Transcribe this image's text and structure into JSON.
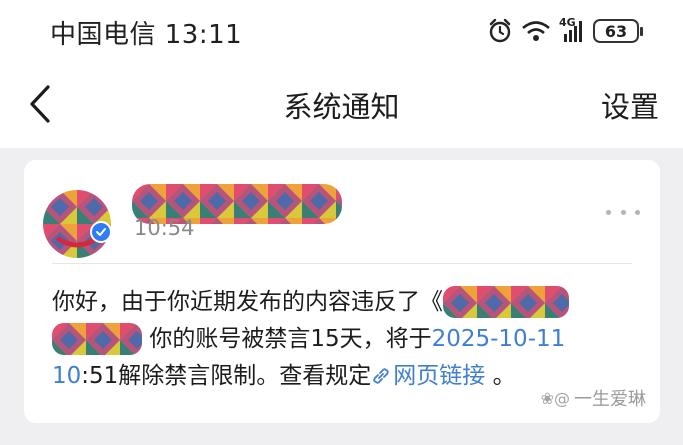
{
  "status_bar": {
    "carrier_time": "中国电信 13:11",
    "battery": "63",
    "network": "4G",
    "icons": [
      "alarm-icon",
      "wifi-icon",
      "signal-icon",
      "battery-icon"
    ]
  },
  "nav": {
    "back_icon": "chevron-left-icon",
    "title": "系统通知",
    "settings_label": "设置"
  },
  "message": {
    "time": "10:54",
    "more_icon": "more-dots-icon",
    "text_intro": "你好，由于你近期发布的内容违反了《",
    "text_part2": "你的账号被禁言15天，将于",
    "text_date": "2025-10-11",
    "text_time": "10",
    "text_part3": ":51解除禁言限制。查看规定",
    "link_icon": "link-icon",
    "link_label": "网页链接",
    "text_end": " 。"
  },
  "watermark": {
    "logo": "❀@",
    "text": "一生爱琳"
  },
  "colors": {
    "link": "#3f7fd2",
    "background": "#efeff1",
    "card": "#ffffff",
    "verified_badge": "#2f7cf6"
  }
}
